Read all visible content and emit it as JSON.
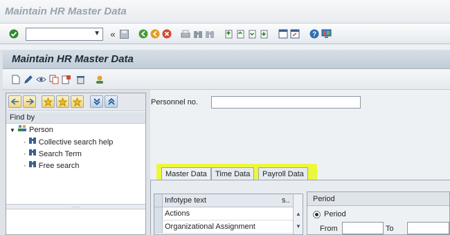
{
  "window": {
    "title": "Maintain HR Master Data"
  },
  "toolbar": {
    "command_field_value": "",
    "icons": [
      "enter-icon",
      "command-dropdown-icon",
      "collapse-icon",
      "save-icon",
      "back-icon",
      "exit-icon",
      "cancel-icon",
      "print-icon",
      "find-icon",
      "find-next-icon",
      "first-page-icon",
      "previous-page-icon",
      "next-page-icon",
      "last-page-icon",
      "new-session-icon",
      "shortcut-icon",
      "help-icon",
      "customize-layout-icon"
    ]
  },
  "header": {
    "title": "Maintain HR Master Data"
  },
  "app_toolbar": {
    "icons": [
      "create-icon",
      "change-icon",
      "display-icon",
      "copy-icon",
      "delimit-icon",
      "delete-icon",
      "overview-icon"
    ]
  },
  "left_panel": {
    "find_by_label": "Find by",
    "tree": {
      "root": "Person",
      "children": [
        "Collective search help",
        "Search Term",
        "Free search"
      ]
    }
  },
  "personnel": {
    "label": "Personnel no.",
    "value": ""
  },
  "tabs": [
    {
      "label": "Master Data",
      "active": true
    },
    {
      "label": "Time Data",
      "active": false
    },
    {
      "label": "Payroll Data",
      "active": false
    }
  ],
  "infotype_table": {
    "headers": {
      "text": "Infotype text",
      "s": "s.."
    },
    "rows": [
      "Actions",
      "Organizational Assignment"
    ]
  },
  "period": {
    "title": "Period",
    "option": "Period",
    "from_label": "From",
    "to_label": "To",
    "from_value": "",
    "to_value": ""
  },
  "colors": {
    "highlight": "#ecf83a",
    "header_bg": "#c2ccd8",
    "accent_green": "#2e8b2e"
  }
}
